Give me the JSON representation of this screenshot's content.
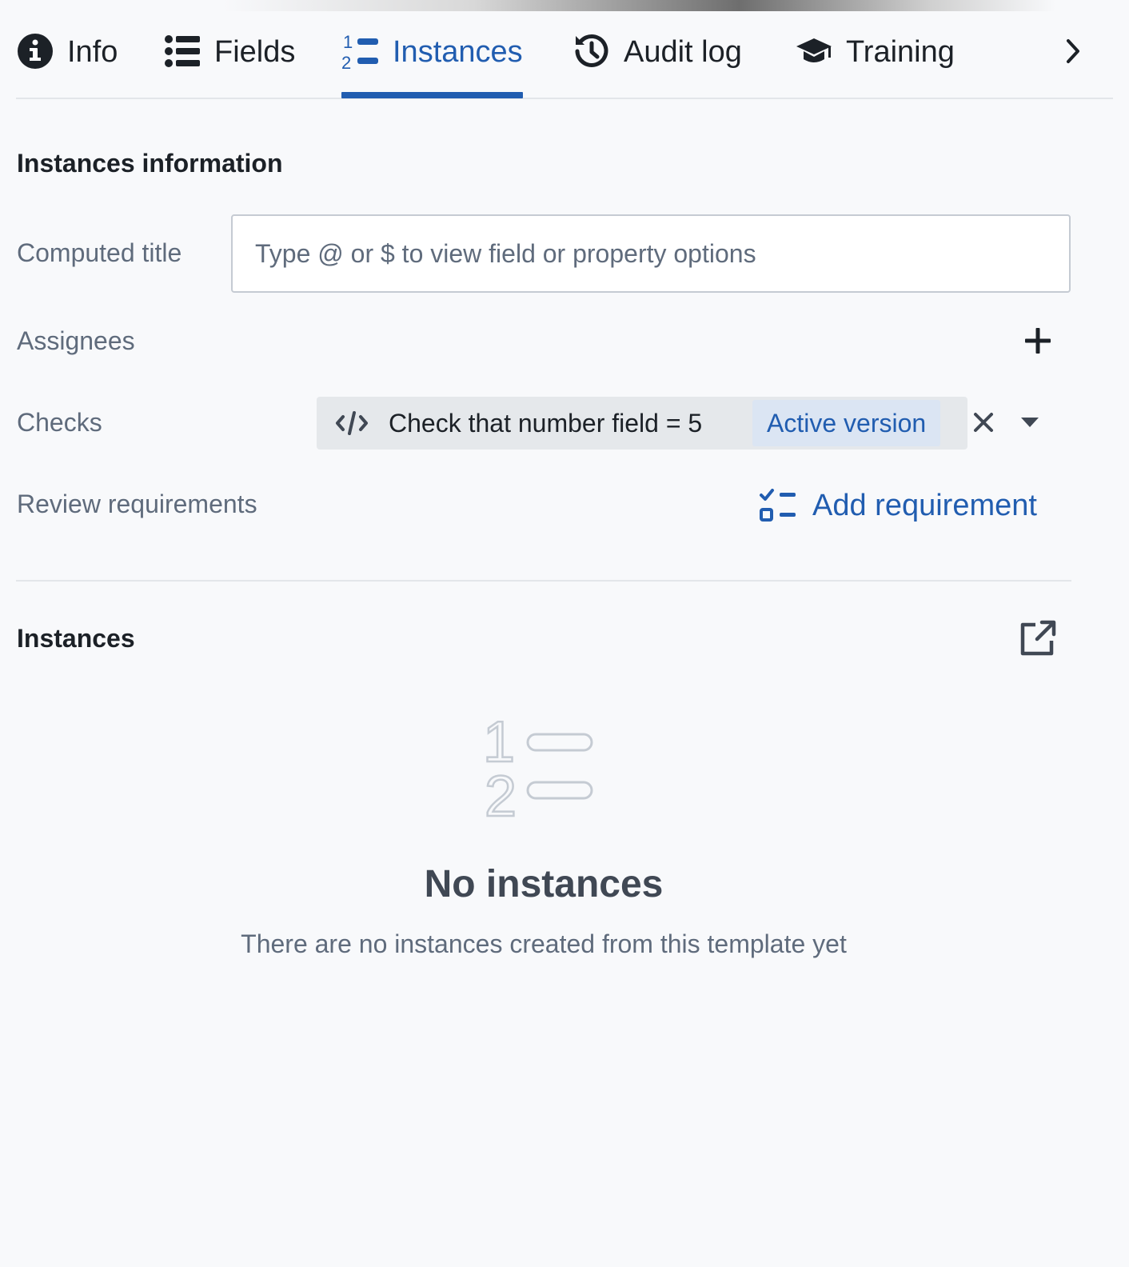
{
  "tabs": [
    {
      "label": "Info",
      "icon": "info-icon",
      "active": false
    },
    {
      "label": "Fields",
      "icon": "properties-icon",
      "active": false
    },
    {
      "label": "Instances",
      "icon": "numbered-list-icon",
      "active": true
    },
    {
      "label": "Audit log",
      "icon": "history-icon",
      "active": false
    },
    {
      "label": "Training",
      "icon": "graduation-cap-icon",
      "active": false
    }
  ],
  "instances_information": {
    "heading": "Instances information",
    "computed_title": {
      "label": "Computed title",
      "value": "",
      "placeholder": "Type @ or $ to view field or property options"
    },
    "assignees": {
      "label": "Assignees"
    },
    "checks": {
      "label": "Checks",
      "tag_text": "Check that number field = 5",
      "tag_badge": "Active version"
    },
    "review_requirements": {
      "label": "Review requirements",
      "add_label": "Add requirement"
    }
  },
  "instances": {
    "heading": "Instances",
    "empty_title": "No instances",
    "empty_description": "There are no instances created from this template yet"
  },
  "colors": {
    "accent": "#215db0",
    "background": "#f8f9fb",
    "text": "#1c2127",
    "muted_text": "#5f6b7c",
    "tag_background": "#e5e8eb",
    "badge_background": "#dbe5f3"
  }
}
